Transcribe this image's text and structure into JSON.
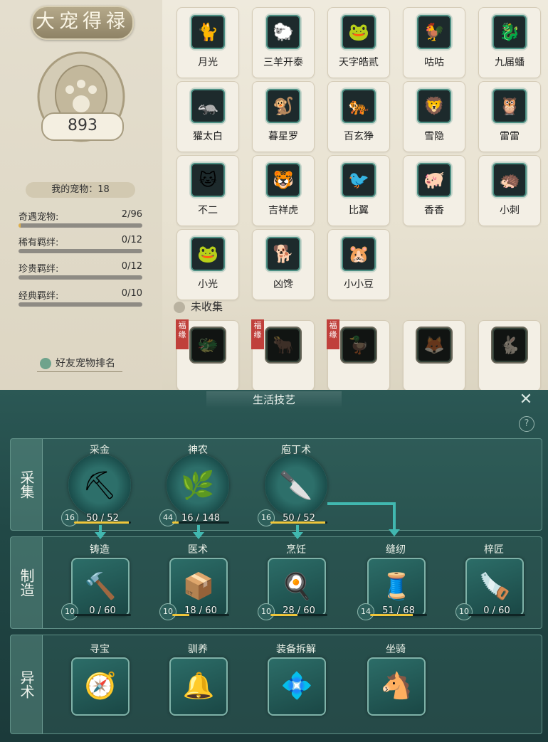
{
  "pet_panel": {
    "title": "大宠得禄",
    "score": "893",
    "my_pets": "我的宠物：18",
    "stats": [
      {
        "label": "奇遇宠物:",
        "value": "2/96",
        "progress": 0.02
      },
      {
        "label": "稀有羁绊:",
        "value": "0/12",
        "progress": 0
      },
      {
        "label": "珍贵羁绊:",
        "value": "0/12",
        "progress": 0
      },
      {
        "label": "经典羁绊:",
        "value": "0/10",
        "progress": 0
      }
    ],
    "friend_rank": "好友宠物排名",
    "uncollected_label": "未收集",
    "pets": [
      {
        "name": "月光",
        "icon": "🐈"
      },
      {
        "name": "三羊开泰",
        "icon": "🐑"
      },
      {
        "name": "天字皓贰",
        "icon": "🐸"
      },
      {
        "name": "咕咕",
        "icon": "🐓"
      },
      {
        "name": "九届蟠",
        "icon": "🐉"
      },
      {
        "name": "獾太白",
        "icon": "🦡"
      },
      {
        "name": "暮星罗",
        "icon": "🐒"
      },
      {
        "name": "百玄狰",
        "icon": "🐅"
      },
      {
        "name": "雪隐",
        "icon": "🦁"
      },
      {
        "name": "雷雷",
        "icon": "🦉"
      },
      {
        "name": "不二",
        "icon": "🐱"
      },
      {
        "name": "吉祥虎",
        "icon": "🐯"
      },
      {
        "name": "比翼",
        "icon": "🐦"
      },
      {
        "name": "香香",
        "icon": "🐖"
      },
      {
        "name": "小刺",
        "icon": "🦔"
      },
      {
        "name": "小光",
        "icon": "🐸"
      },
      {
        "name": "凶馋",
        "icon": "🐕"
      },
      {
        "name": "小小豆",
        "icon": "🐹"
      }
    ],
    "locked_pets": [
      {
        "tag": "福缘",
        "name": "",
        "icon": "🐲"
      },
      {
        "tag": "福缘",
        "name": "",
        "icon": "🐂"
      },
      {
        "tag": "福缘",
        "name": "",
        "icon": "🦆"
      },
      {
        "tag": "",
        "name": "",
        "icon": "🦊"
      },
      {
        "tag": "",
        "name": "",
        "icon": "🐇"
      }
    ]
  },
  "skills_window": {
    "title": "生活技艺",
    "close_glyph": "✕",
    "help_glyph": "?",
    "rows": {
      "gather": "采集",
      "craft": "制造",
      "special": "异术"
    },
    "gather_skills": [
      {
        "name": "采金",
        "level": "16",
        "progress": "50 / 52",
        "ratio": 0.96,
        "icon": "⛏"
      },
      {
        "name": "神农",
        "level": "44",
        "progress": "16 / 148",
        "ratio": 0.11,
        "icon": "🌿"
      },
      {
        "name": "庖丁术",
        "level": "16",
        "progress": "50 / 52",
        "ratio": 0.96,
        "icon": "🔪"
      }
    ],
    "craft_skills": [
      {
        "name": "铸造",
        "level": "10",
        "progress": "0 / 60",
        "ratio": 0,
        "icon": "🔨"
      },
      {
        "name": "医术",
        "level": "10",
        "progress": "18 / 60",
        "ratio": 0.3,
        "icon": "📦"
      },
      {
        "name": "烹饪",
        "level": "10",
        "progress": "28 / 60",
        "ratio": 0.47,
        "icon": "🍳"
      },
      {
        "name": "缝纫",
        "level": "14",
        "progress": "51 / 68",
        "ratio": 0.75,
        "icon": "🧵"
      },
      {
        "name": "梓匠",
        "level": "10",
        "progress": "0 / 60",
        "ratio": 0,
        "icon": "🪚"
      }
    ],
    "special_skills": [
      {
        "name": "寻宝",
        "icon": "🧭"
      },
      {
        "name": "驯养",
        "icon": "🔔"
      },
      {
        "name": "装备拆解",
        "icon": "💠"
      },
      {
        "name": "坐骑",
        "icon": "🐴"
      }
    ]
  }
}
